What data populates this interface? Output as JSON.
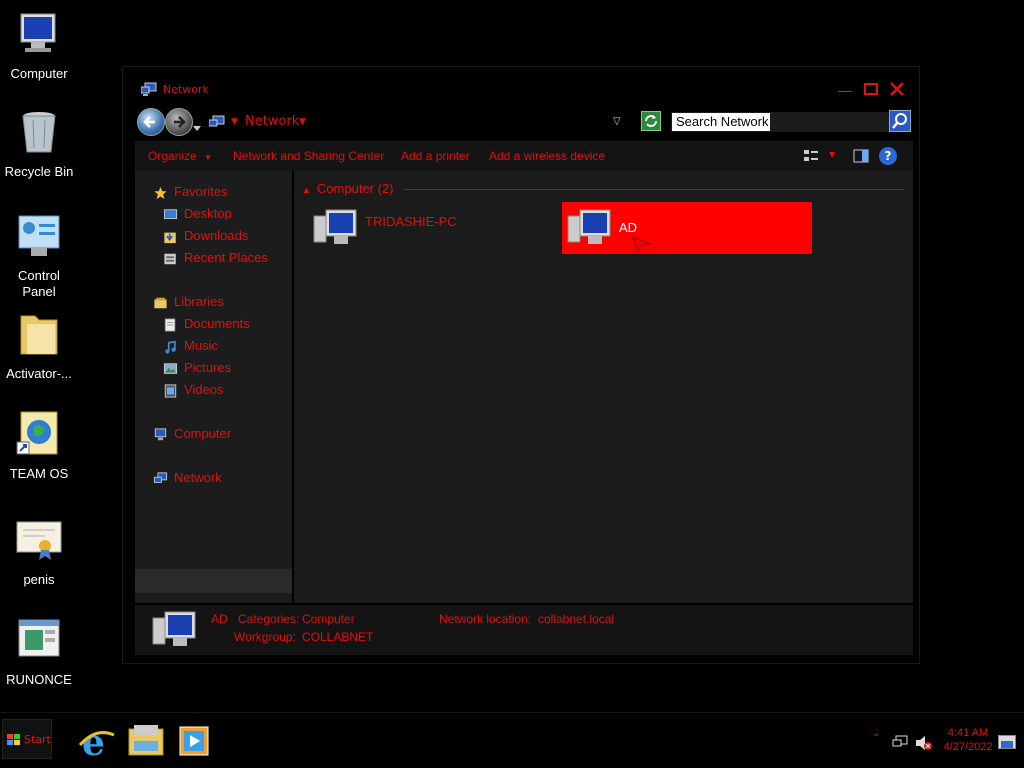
{
  "desktop": {
    "icons": [
      {
        "label": "Computer"
      },
      {
        "label": "Recycle Bin"
      },
      {
        "label": "Control Panel"
      },
      {
        "label": "Activator-..."
      },
      {
        "label": "TEAM OS"
      },
      {
        "label": "penis"
      },
      {
        "label": "RUNONCE"
      }
    ]
  },
  "window": {
    "title": "Network",
    "address": {
      "segment": "Network"
    },
    "search": {
      "placeholder": "Search Network"
    },
    "toolbar": {
      "organize": "Organize",
      "network_sharing": "Network and Sharing Center",
      "add_printer": "Add a printer",
      "add_wireless": "Add a wireless device"
    },
    "nav": {
      "favorites": "Favorites",
      "desktop": "Desktop",
      "downloads": "Downloads",
      "recent": "Recent Places",
      "libraries": "Libraries",
      "documents": "Documents",
      "music": "Music",
      "pictures": "Pictures",
      "videos": "Videos",
      "computer": "Computer",
      "network": "Network"
    },
    "content": {
      "group_header": "Computer (2)",
      "items": [
        {
          "label": "TRIDASHIE-PC",
          "selected": false
        },
        {
          "label": "AD",
          "selected": true
        }
      ]
    },
    "details": {
      "name": "AD",
      "categories_label": "Categories:",
      "categories_value": "Computer",
      "workgroup_label": "Workgroup:",
      "workgroup_value": "COLLABNET",
      "location_label": "Network location:",
      "location_value": "collabnet.local"
    }
  },
  "taskbar": {
    "start": "Start",
    "time": "4:41 AM",
    "date": "4/27/2022"
  },
  "colors": {
    "accent": "#e01010",
    "selection": "#ff0000"
  }
}
